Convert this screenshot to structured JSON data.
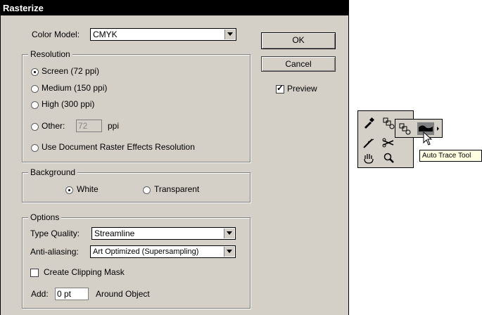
{
  "dialog": {
    "title": "Rasterize",
    "color_model_label": "Color Model:",
    "color_model_value": "CMYK",
    "buttons": {
      "ok": "OK",
      "cancel": "Cancel"
    },
    "preview_label": "Preview",
    "preview_checked": true
  },
  "resolution": {
    "legend": "Resolution",
    "options": [
      {
        "label": "Screen (72 ppi)",
        "selected": true
      },
      {
        "label": "Medium (150 ppi)",
        "selected": false
      },
      {
        "label": "High (300 ppi)",
        "selected": false
      },
      {
        "label": "Other:",
        "selected": false
      },
      {
        "label": "Use Document Raster Effects Resolution",
        "selected": false
      }
    ],
    "other_value": "72",
    "other_unit": "ppi"
  },
  "background": {
    "legend": "Background",
    "white_label": "White",
    "transparent_label": "Transparent",
    "selected": "White"
  },
  "options": {
    "legend": "Options",
    "type_quality_label": "Type Quality:",
    "type_quality_value": "Streamline",
    "anti_aliasing_label": "Anti-aliasing:",
    "anti_aliasing_value": "Art Optimized (Supersampling)",
    "clipping_mask_label": "Create Clipping Mask",
    "clipping_mask_checked": false,
    "add_label": "Add:",
    "add_value": "0 pt",
    "around_label": "Around Object"
  },
  "toolbox": {
    "tooltip": "Auto Trace Tool",
    "icons": [
      "eyedropper-icon",
      "blend-tool-icon",
      "auto-trace-icon",
      "slice-icon",
      "scissors-icon",
      "hand-icon",
      "zoom-icon",
      "cursor-arrow-icon"
    ]
  }
}
